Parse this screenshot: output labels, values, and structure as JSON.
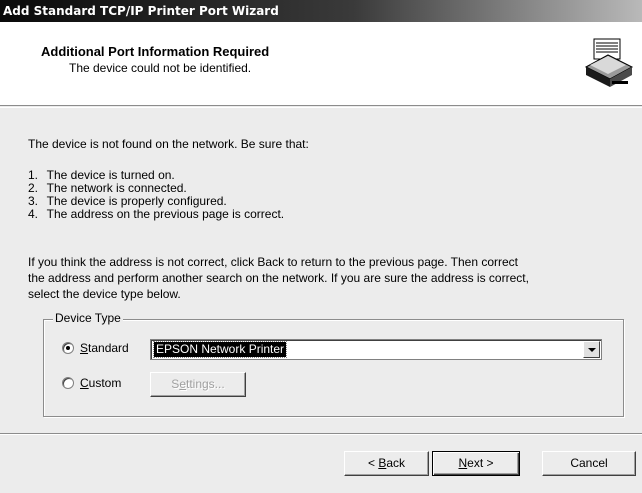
{
  "window": {
    "title": "Add Standard TCP/IP Printer Port Wizard"
  },
  "header": {
    "title": "Additional Port Information Required",
    "subtitle": "The device could not be identified.",
    "icon": "printer-port-icon"
  },
  "body": {
    "intro": "The device is not found on the network.  Be sure that:",
    "checklist": [
      {
        "num": "1.",
        "text": "The device is turned on."
      },
      {
        "num": "2.",
        "text": "The network is connected."
      },
      {
        "num": "3.",
        "text": "The device is properly configured."
      },
      {
        "num": "4.",
        "text": "The address on the previous page is correct."
      }
    ],
    "instructions": [
      "If you think the address is not correct, click Back to return to the previous page.  Then correct",
      "the address and perform another search on the network.  If you are sure the address is correct,",
      "select the device type below."
    ]
  },
  "device_type": {
    "label": "Device Type",
    "standard": {
      "accel": "S",
      "rest": "tandard",
      "checked": true
    },
    "custom": {
      "accel": "C",
      "rest": "ustom",
      "checked": false
    },
    "selected_device": "EPSON Network Printer",
    "settings": {
      "pre": "S",
      "accel": "e",
      "rest": "ttings..."
    }
  },
  "buttons": {
    "back": {
      "pre": "< ",
      "accel": "B",
      "rest": "ack"
    },
    "next": {
      "accel": "N",
      "rest": "ext >"
    },
    "cancel": "Cancel"
  }
}
